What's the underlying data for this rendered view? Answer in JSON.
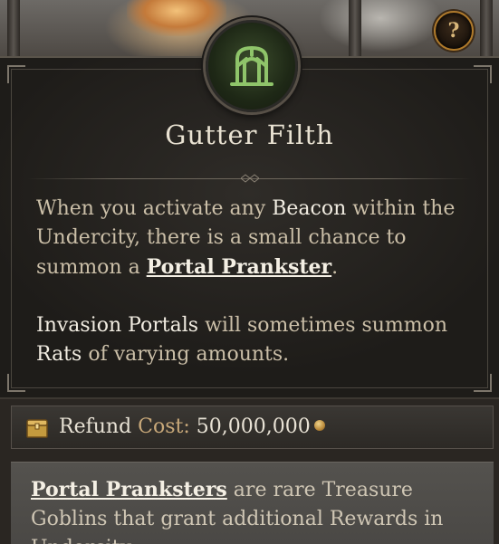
{
  "help": {
    "label": "?"
  },
  "title": "Gutter Filth",
  "description": {
    "p1_part1": "When you activate any ",
    "p1_beacon": "Beacon",
    "p1_part2": " within the Undercity, there is a small chance to summon a ",
    "p1_link": "Portal Prankster",
    "p1_end": ".",
    "p2_hl1": "Invasion Portals",
    "p2_part1": " will sometimes summon ",
    "p2_hl2": "Rats",
    "p2_part2": " of varying amounts."
  },
  "cost": {
    "refund_label": "Refund ",
    "cost_label": "Cost:",
    "amount": " 50,000,000",
    "icon": "chest-icon",
    "currency_icon": "gold-coin-icon"
  },
  "footer": {
    "link": "Portal Pranksters",
    "text": " are rare Treasure Goblins that grant additional Rewards in Undercity."
  },
  "colors": {
    "emblem_green": "#8fc46a",
    "accent_gold": "#b07a2a"
  }
}
